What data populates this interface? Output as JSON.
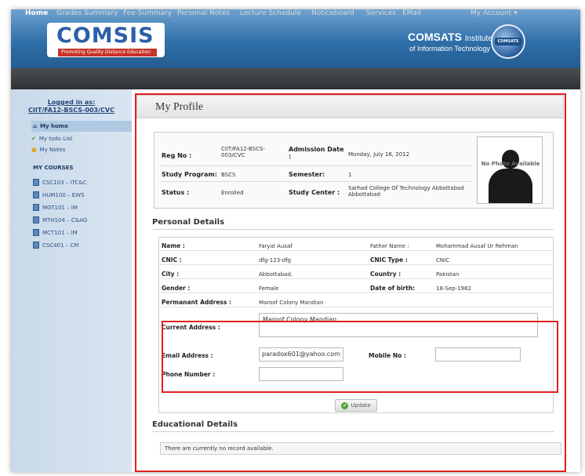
{
  "header": {
    "logo_text": "COMSIS",
    "logo_tagline": "Promoting Quality Distance Education",
    "institute_name": "COMSATS",
    "institute_name_suffix": "Institute",
    "institute_sub": "of Information Technology",
    "globe_label": "COMSATS"
  },
  "nav": {
    "items": [
      "Home",
      "Grades Summary",
      "Fee Summary",
      "Personal Notes",
      "Lecture Schedule",
      "Noticeboard",
      "Services",
      "EMail"
    ],
    "account": "My Account"
  },
  "sidebar": {
    "logged_label": "Logged in as:",
    "logged_user": "CIIT/FA12-BSCS-003/CVC",
    "links": [
      "My home",
      "My todo List",
      "My Notes"
    ],
    "courses_heading": "MY COURSES",
    "courses": [
      "CSC103 – ITC&C",
      "HUM100 – EWS",
      "MGT101 – IM",
      "MTH104 – C&AG",
      "MCT101 – IM",
      "CSC401 – CM"
    ]
  },
  "main": {
    "title": "My Profile",
    "summary": {
      "reg_no_label": "Reg No :",
      "reg_no": "CIIT/FA12-BSCS-003/CVC",
      "admission_label": "Admission Date :",
      "admission_date": "Monday, July 16, 2012",
      "program_label": "Study Program:",
      "program": "BSCS",
      "semester_label": "Semester:",
      "semester": "1",
      "status_label": "Status :",
      "status": "Enrolled",
      "center_label": "Study Center :",
      "center": "Sarhad College Of Technology Abbottabad Abbottabad",
      "photo_text": "No Photo Available"
    },
    "personal_title": "Personal Details",
    "personal": {
      "name_label": "Name :",
      "name": "Faryal Ausaf",
      "father_label": "Father Name :",
      "father": "Mohammad Ausaf Ur Rehman",
      "cnic_label": "CNIC :",
      "cnic": "dfg-123-dfg",
      "cnic_type_label": "CNIC Type :",
      "cnic_type": "CNIC",
      "city_label": "City :",
      "city": "Abbottabad.",
      "country_label": "Country :",
      "country": "Pakistan",
      "gender_label": "Gender :",
      "gender": "Female",
      "dob_label": "Date of birth:",
      "dob": "18-Sep-1982",
      "perm_label": "Permanant Address :",
      "perm": "Maroof Colony Mandian",
      "current_label": "Current Address :",
      "current": "Maroof Colony Mandian",
      "email_label": "Email Address :",
      "email": "paradox601@yahoo.com",
      "mobile_label": "Mobile No :",
      "mobile": "",
      "phone_label": "Phone Number :",
      "phone": ""
    },
    "update_label": "Update",
    "education_title": "Educational Details",
    "no_record": "There are currently no record available."
  }
}
